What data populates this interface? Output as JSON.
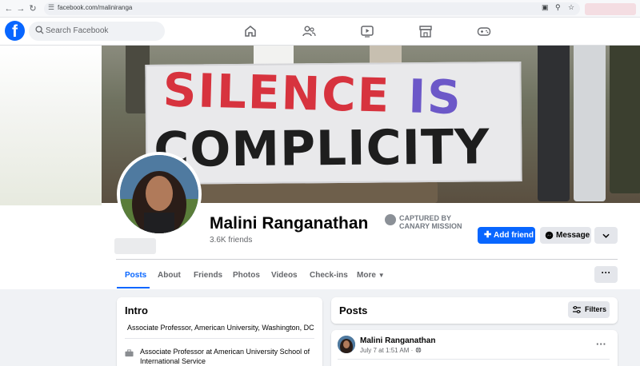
{
  "browser": {
    "url": "facebook.com/maliniranga",
    "icons": [
      "back-arrow",
      "forward-arrow",
      "reload",
      "site-settings",
      "install-app",
      "zoom",
      "bookmark-star"
    ]
  },
  "nav": {
    "logo": "f",
    "search_placeholder": "Search Facebook",
    "icons": [
      "home-icon",
      "friends-icon",
      "video-icon",
      "marketplace-icon",
      "gaming-icon"
    ]
  },
  "cover": {
    "banner_line1_red": "SILENCE ",
    "banner_line1_blue": "IS",
    "banner_line2": "COMPLICITY"
  },
  "profile": {
    "name": "Malini Ranganathan",
    "friends": "3.6K friends",
    "add_friend": "Add friend",
    "message": "Message",
    "watermark": [
      "CAPTURED BY",
      "CANARY MISSION"
    ]
  },
  "tabs": [
    "Posts",
    "About",
    "Friends",
    "Photos",
    "Videos",
    "Check-ins",
    "More"
  ],
  "active_tab": "Posts",
  "intro": {
    "title": "Intro",
    "bio": "Associate Professor, American University, Washington, DC",
    "work": "Associate Professor at American University School of International Service"
  },
  "posts": {
    "title": "Posts",
    "filters": "Filters",
    "first_post": {
      "author": "Malini Ranganathan",
      "time": "July 7 at 1:51 AM ·"
    }
  },
  "colors": {
    "accent": "#0866ff",
    "banner_red": "#d7333e",
    "banner_blue": "#6c58c8"
  }
}
